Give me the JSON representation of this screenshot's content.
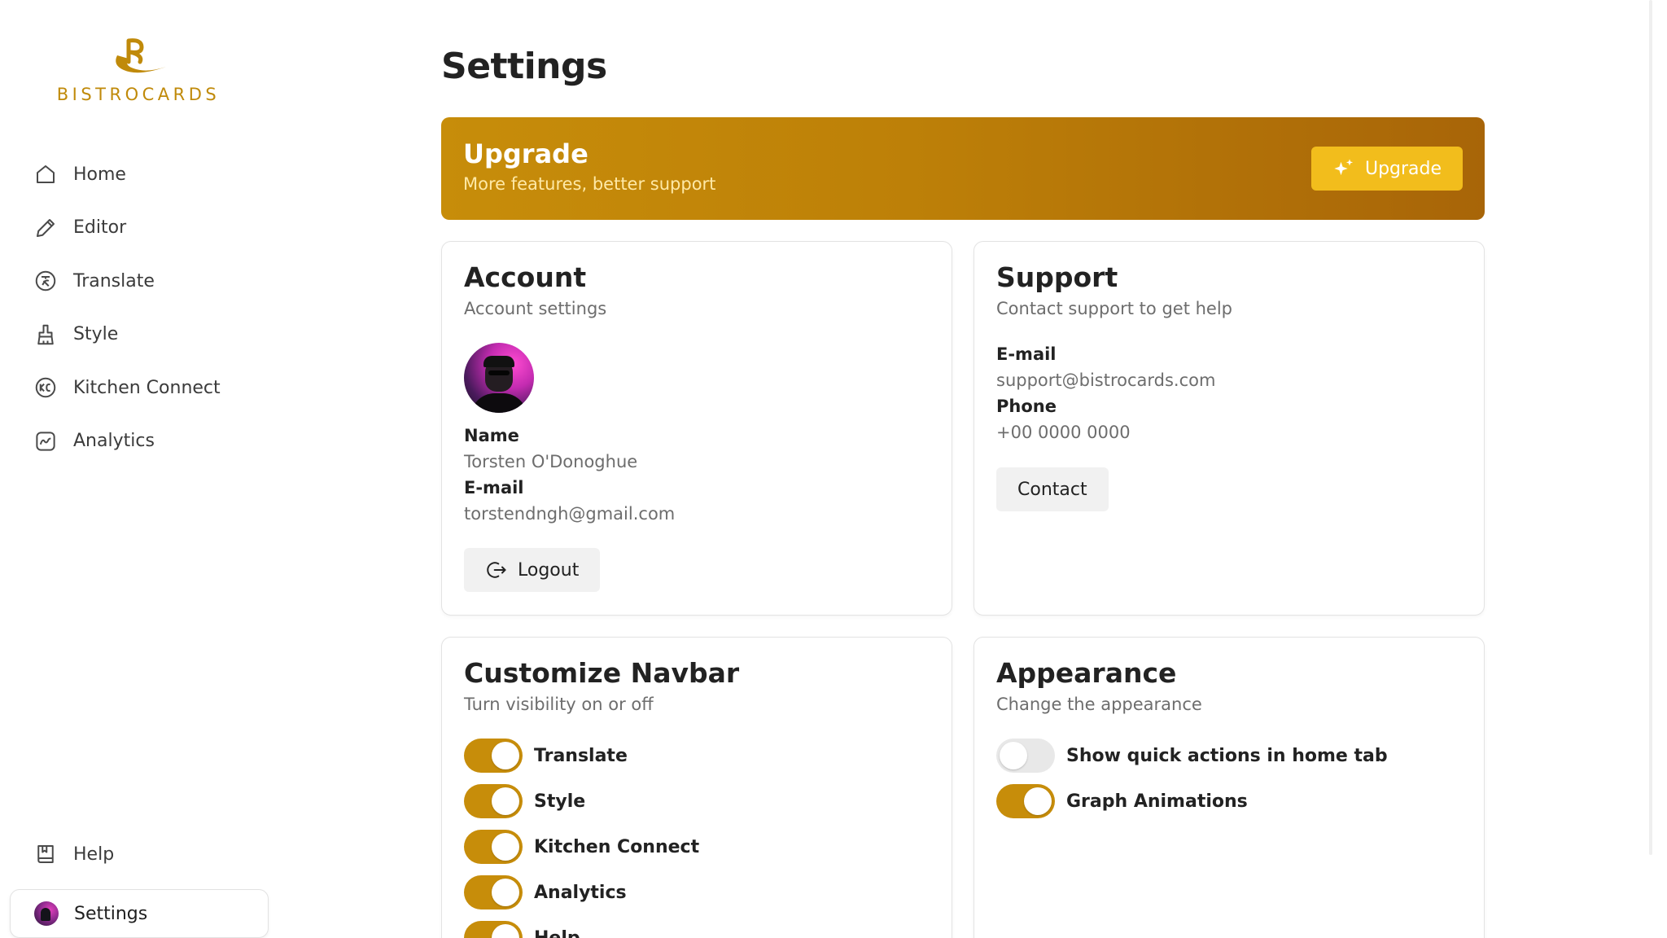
{
  "brand": {
    "name": "BISTROCARDS",
    "accent": "#c78d0a"
  },
  "sidebar": {
    "items": [
      {
        "label": "Home",
        "icon": "home-icon"
      },
      {
        "label": "Editor",
        "icon": "pencil-icon"
      },
      {
        "label": "Translate",
        "icon": "translate-icon"
      },
      {
        "label": "Style",
        "icon": "brush-icon"
      },
      {
        "label": "Kitchen Connect",
        "icon": "kitchen-connect-icon"
      },
      {
        "label": "Analytics",
        "icon": "analytics-icon"
      }
    ],
    "bottom": {
      "help": {
        "label": "Help",
        "icon": "book-icon"
      },
      "settings": {
        "label": "Settings",
        "icon": "avatar"
      }
    }
  },
  "page": {
    "title": "Settings"
  },
  "upgrade": {
    "title": "Upgrade",
    "subtitle": "More features, better support",
    "button": "Upgrade"
  },
  "account": {
    "title": "Account",
    "subtitle": "Account settings",
    "name_label": "Name",
    "name_value": "Torsten O'Donoghue",
    "email_label": "E-mail",
    "email_value": "torstendngh@gmail.com",
    "logout": "Logout"
  },
  "support": {
    "title": "Support",
    "subtitle": "Contact support to get help",
    "email_label": "E-mail",
    "email_value": "support@bistrocards.com",
    "phone_label": "Phone",
    "phone_value": "+00 0000 0000",
    "contact": "Contact"
  },
  "navbar": {
    "title": "Customize Navbar",
    "subtitle": "Turn visibility on or off",
    "toggles": [
      {
        "label": "Translate",
        "on": true
      },
      {
        "label": "Style",
        "on": true
      },
      {
        "label": "Kitchen Connect",
        "on": true
      },
      {
        "label": "Analytics",
        "on": true
      },
      {
        "label": "Help",
        "on": true
      }
    ]
  },
  "appearance": {
    "title": "Appearance",
    "subtitle": "Change the appearance",
    "toggles": [
      {
        "label": "Show quick actions in home tab",
        "on": false
      },
      {
        "label": "Graph Animations",
        "on": true
      }
    ]
  }
}
